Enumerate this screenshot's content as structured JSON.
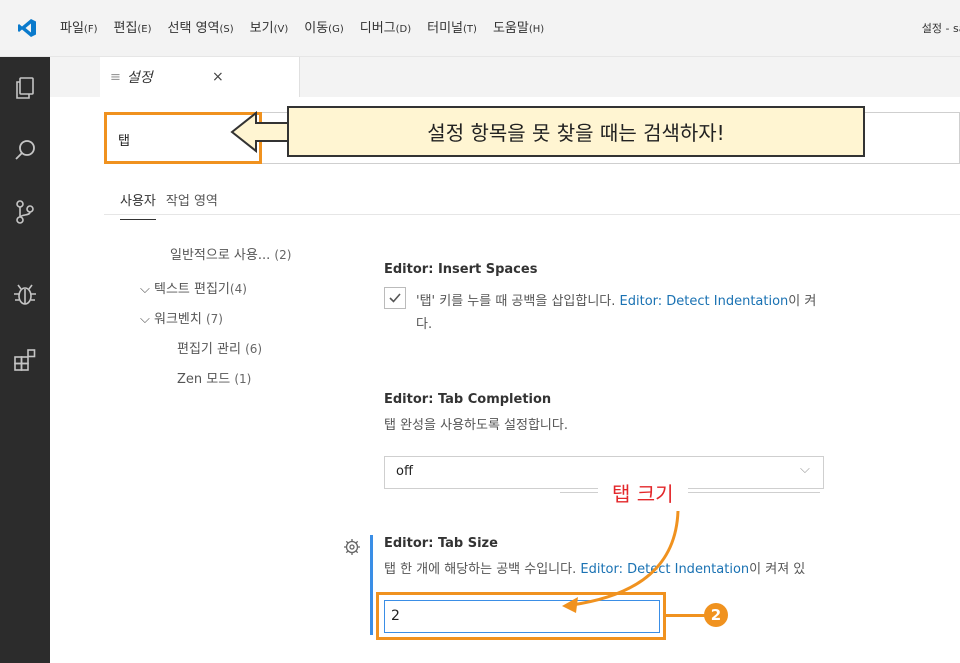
{
  "menu": {
    "items": [
      {
        "label": "파일",
        "key": "(F)"
      },
      {
        "label": "편집",
        "key": "(E)"
      },
      {
        "label": "선택 영역",
        "key": "(S)"
      },
      {
        "label": "보기",
        "key": "(V)"
      },
      {
        "label": "이동",
        "key": "(G)"
      },
      {
        "label": "디버그",
        "key": "(D)"
      },
      {
        "label": "터미널",
        "key": "(T)"
      },
      {
        "label": "도움말",
        "key": "(H)"
      }
    ],
    "window_title": "설정 - sar"
  },
  "tab": {
    "label": "설정",
    "close": "×"
  },
  "search": {
    "value": "탭"
  },
  "callout": {
    "text": "설정 항목을 못 찾을 때는 검색하자!"
  },
  "scope": {
    "user": "사용자",
    "workspace": "작업 영역"
  },
  "toc": {
    "items": [
      {
        "label": "일반적으로 사용...",
        "count": "(2)"
      },
      {
        "label": "텍스트 편집기",
        "count": "(4)"
      },
      {
        "label": "워크벤치",
        "count": "(7)"
      },
      {
        "label": "편집기 관리",
        "count": "(6)"
      },
      {
        "label": "Zen 모드",
        "count": "(1)"
      }
    ]
  },
  "settings": {
    "insert_spaces": {
      "category": "Editor: ",
      "name": "Insert Spaces",
      "desc_before": "'탭' 키를 누를 때 공백을 삽입합니다. ",
      "desc_link": "Editor: Detect Indentation",
      "desc_after": "이 켜",
      "desc_line2": "다."
    },
    "tab_completion": {
      "category": "Editor: ",
      "name": "Tab Completion",
      "desc": "탭 완성을 사용하도록 설정합니다.",
      "value": "off"
    },
    "tab_size": {
      "category": "Editor: ",
      "name": "Tab Size",
      "desc_before": "탭 한 개에 해당하는 공백 수입니다. ",
      "desc_link": "Editor: Detect Indentation",
      "desc_after": "이 켜져 있",
      "value": "2"
    }
  },
  "annotation": {
    "label": "탭 크기",
    "badge": "2"
  },
  "colors": {
    "highlight": "#f0921f",
    "callout_bg": "#fff5d2",
    "annotation_red": "#e3272a",
    "link": "#1a72b3",
    "focus": "#3a8ee6"
  }
}
